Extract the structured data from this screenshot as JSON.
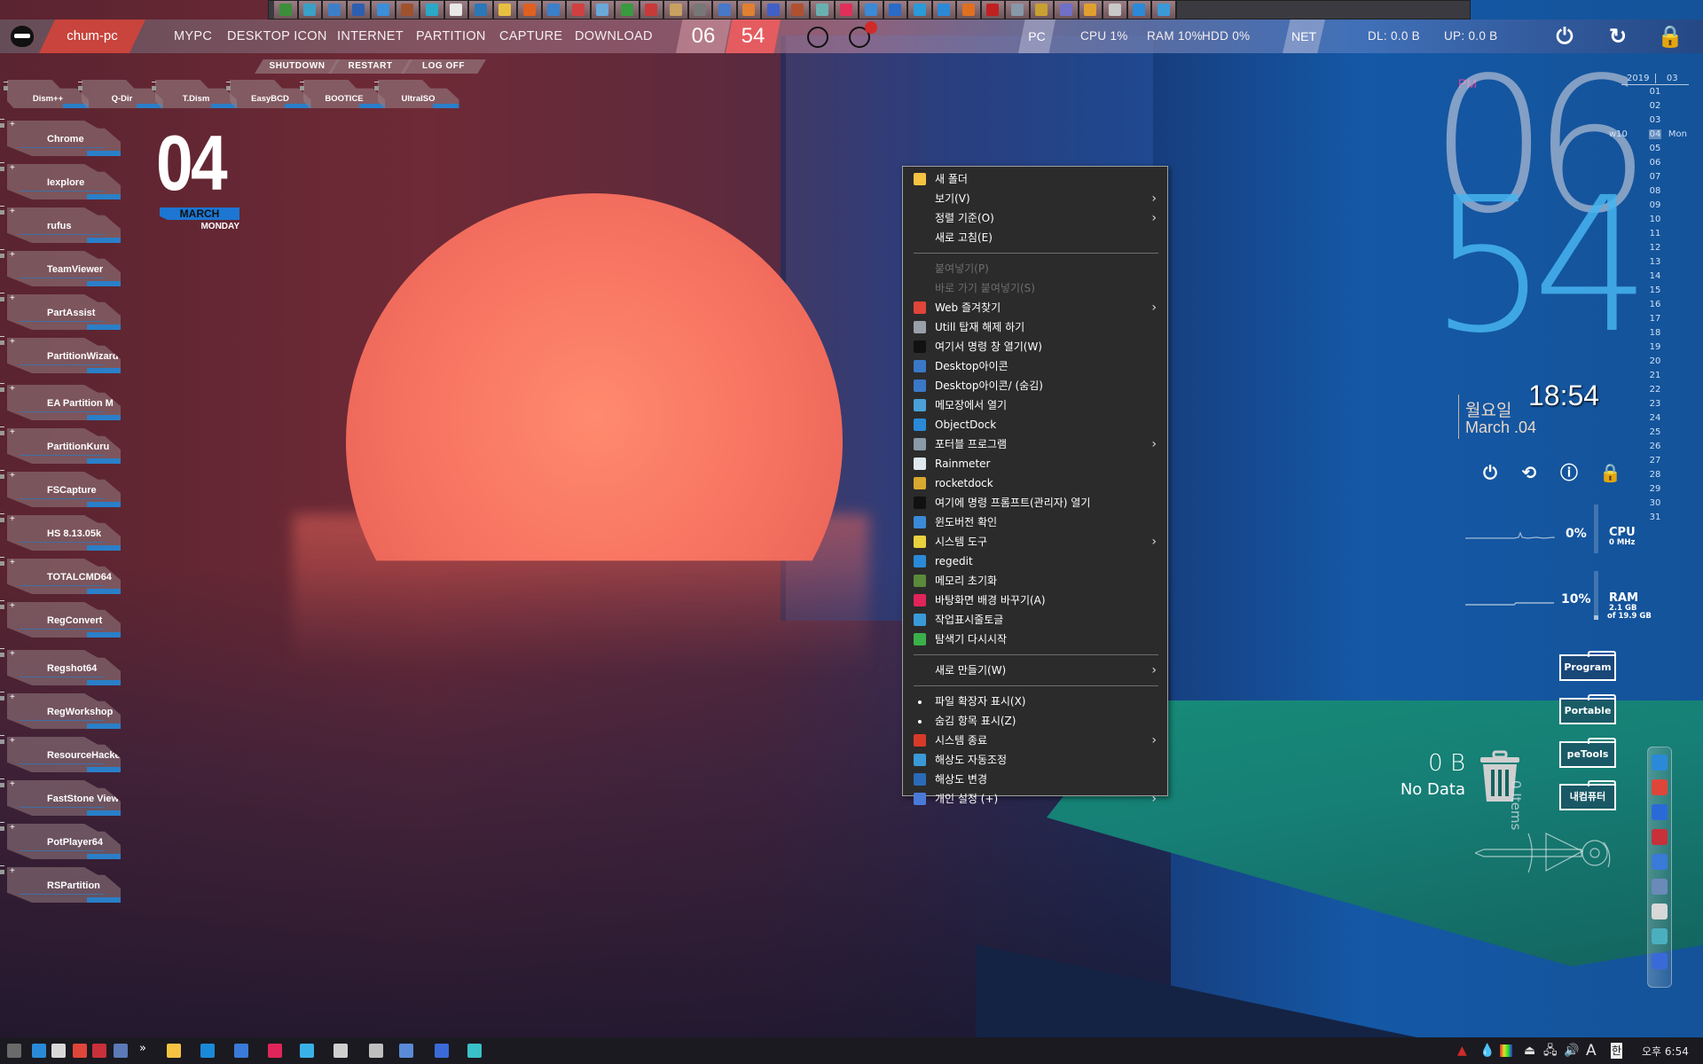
{
  "top_dock": {
    "icons": [
      "windows-flag",
      "delta-triangle",
      "tiles",
      "a-app",
      "cubes",
      "bridge",
      "cyan-circle",
      "usb-drive",
      "backup-clock",
      "wand",
      "orange-doc",
      "pen-tool",
      "colorful-orb",
      "monitor-drop",
      "green-drive",
      "ms-office",
      "cd-drive",
      "usb-stick",
      "pc-setup",
      "orange-disc",
      "floppy-save",
      "recovery-text",
      "tall-doc",
      "pink-monitor",
      "gears",
      "web-globe",
      "teamviewer-ring",
      "ie",
      "firefox",
      "red-window",
      "water-drop",
      "rocketdock-r",
      "paint",
      "rs-logo",
      "doc-pen",
      "play-triangle",
      "blue-cog"
    ],
    "colors": [
      "#3c8f3a",
      "#3aa0c8",
      "#3c7fc8",
      "#2c5fb0",
      "#3a8fd8",
      "#a0522d",
      "#2aa8c8",
      "#e8e8e8",
      "#2a78b8",
      "#e8c040",
      "#e06020",
      "#3a7fc8",
      "#d04040",
      "#6aa8d8",
      "#3a9a40",
      "#c83a3a",
      "#c8a060",
      "#777777",
      "#4878c8",
      "#e08030",
      "#4060c8",
      "#b05030",
      "#6ab0b0",
      "#e0305a",
      "#3a8ad8",
      "#2a6ac8",
      "#2a9ad8",
      "#2a8ad8",
      "#e07020",
      "#c02020",
      "#8898a8",
      "#c8a030",
      "#7070c8",
      "#e0a030",
      "#c8c8c8",
      "#2a8ad8",
      "#3a9ad8"
    ]
  },
  "topbar": {
    "host": "chum-pc",
    "menu": [
      "MYPC",
      "DESKTOP ICON",
      "INTERNET",
      "PARTITION",
      "CAPTURE",
      "DOWNLOAD"
    ],
    "clock_hour": "06",
    "clock_minute": "54",
    "pc_tag": "PC",
    "cpu": "CPU  1%",
    "ram": "RAM  10%",
    "hdd": "HDD  0%",
    "net_tag": "NET",
    "dl": "DL: 0.0 B",
    "up": "UP: 0.0 B"
  },
  "launcher": {
    "system": [
      "SHUTDOWN",
      "RESTART",
      "LOG OFF"
    ],
    "top_tiles": [
      "Dism++",
      "Q-Dir",
      "T.Dism",
      "EasyBCD",
      "BOOTICE",
      "UltraISO"
    ],
    "side_tiles": [
      "Chrome",
      "Iexplore",
      "rufus",
      "TeamViewer",
      "PartAssist",
      "PartitionWizard",
      "EA Partition M",
      "PartitionKuru",
      "FSCapture",
      "HS 8.13.05k",
      "TOTALCMD64",
      "RegConvert",
      "Regshot64",
      "RegWorkshop",
      "ResourceHacker",
      "FastStone Viewer",
      "PotPlayer64",
      "RSPartition"
    ]
  },
  "date_widget": {
    "day": "04",
    "month": "MARCH",
    "weekday": "MONDAY"
  },
  "context_menu": {
    "items": [
      {
        "label": "새 폴더",
        "icon": "folder-icon",
        "color": "#f5c242",
        "type": "item"
      },
      {
        "label": "보기(V)",
        "submenu": true,
        "type": "item"
      },
      {
        "label": "정렬 기준(O)",
        "submenu": true,
        "type": "item"
      },
      {
        "label": "새로 고침(E)",
        "type": "item"
      },
      {
        "type": "separator"
      },
      {
        "label": "붙여넣기(P)",
        "disabled": true,
        "type": "item"
      },
      {
        "label": "바로 가기 붙여넣기(S)",
        "disabled": true,
        "type": "item"
      },
      {
        "label": "Web 즐겨찾기",
        "icon": "chrome-icon",
        "color": "#e0453a",
        "submenu": true,
        "type": "item"
      },
      {
        "label": "Utill 탑재 해제 하기",
        "icon": "unmount-icon",
        "color": "#9aa0a8",
        "type": "item"
      },
      {
        "label": "여기서 명령 창 열기(W)",
        "icon": "cmd-icon",
        "color": "#111111",
        "type": "item"
      },
      {
        "label": "Desktop아이콘",
        "icon": "monitor-icon",
        "color": "#3a78c8",
        "type": "item"
      },
      {
        "label": "Desktop아이콘/ (숨김)",
        "icon": "monitor-icon",
        "color": "#3a78c8",
        "type": "item"
      },
      {
        "label": "메모장에서 열기",
        "icon": "notepad-icon",
        "color": "#4aa0d8",
        "type": "item"
      },
      {
        "label": "ObjectDock",
        "icon": "objectdock-icon",
        "color": "#2a8ad8",
        "type": "item"
      },
      {
        "label": "포터블 프로그램",
        "icon": "portable-icon",
        "color": "#8a9aa8",
        "submenu": true,
        "type": "item"
      },
      {
        "label": "Rainmeter",
        "icon": "rainmeter-drop-icon",
        "color": "#dfe8ef",
        "type": "item"
      },
      {
        "label": "rocketdock",
        "icon": "rocketdock-icon",
        "color": "#d8a830",
        "type": "item"
      },
      {
        "label": "여기에 명령 프롬프트(관리자) 열기",
        "icon": "cmd-icon",
        "color": "#111111",
        "type": "item"
      },
      {
        "label": "윈도버전 확인",
        "icon": "winver-icon",
        "color": "#3a8ad8",
        "type": "item"
      },
      {
        "label": "시스템 도구",
        "icon": "system-tools-icon",
        "color": "#e8d040",
        "submenu": true,
        "type": "item"
      },
      {
        "label": "regedit",
        "icon": "regedit-icon",
        "color": "#2a8ad8",
        "type": "item"
      },
      {
        "label": "메모리 초기화",
        "icon": "memory-icon",
        "color": "#5a8a3a",
        "type": "item"
      },
      {
        "label": "바탕화면 배경 바꾸기(A)",
        "icon": "wallpaper-icon",
        "color": "#e0255a",
        "type": "item"
      },
      {
        "label": "작업표시줄토글",
        "icon": "taskbar-icon",
        "color": "#3a9ad8",
        "type": "item"
      },
      {
        "label": "탐색기 다시시작",
        "icon": "refresh-icon",
        "color": "#3ab04a",
        "type": "item"
      },
      {
        "type": "separator"
      },
      {
        "label": "새로 만들기(W)",
        "submenu": true,
        "type": "item"
      },
      {
        "type": "separator"
      },
      {
        "label": "파일 확장자 표시(X)",
        "bullet": true,
        "type": "item"
      },
      {
        "label": "숨김 항목 표시(Z)",
        "bullet": true,
        "type": "item"
      },
      {
        "label": "시스템 종료",
        "icon": "shutdown-icon",
        "color": "#d83a2a",
        "submenu": true,
        "type": "item"
      },
      {
        "label": "해상도 자동조정",
        "icon": "display-icon",
        "color": "#3a9ad8",
        "type": "item"
      },
      {
        "label": "해상도 변경",
        "icon": "display-icon",
        "color": "#2a6ab8",
        "type": "item"
      },
      {
        "label": "개인 설정 (+)",
        "icon": "personalize-icon",
        "color": "#4a7ad8",
        "submenu": true,
        "type": "item"
      }
    ]
  },
  "right_clock": {
    "ampm": "PM",
    "hour": "06",
    "minute": "54",
    "time24": "18:54",
    "weekday_ko": "월요일",
    "date": "March .04"
  },
  "calendar": {
    "year": "2019",
    "month": "03",
    "week": "w10",
    "today": "04",
    "today_name": "Mon",
    "days": [
      "01",
      "02",
      "03",
      "04",
      "05",
      "06",
      "07",
      "08",
      "09",
      "10",
      "11",
      "12",
      "13",
      "14",
      "15",
      "16",
      "17",
      "18",
      "19",
      "20",
      "21",
      "22",
      "23",
      "24",
      "25",
      "26",
      "27",
      "28",
      "29",
      "30",
      "31"
    ]
  },
  "power_icons": [
    "power-icon",
    "restart-icon",
    "logoff-icon",
    "lock-icon"
  ],
  "meters": {
    "cpu": {
      "name": "CPU",
      "pct_label": "0%",
      "pct": 0,
      "sub": "0 MHz"
    },
    "ram": {
      "name": "RAM",
      "pct_label": "10%",
      "pct": 10,
      "sub1": "2.1 GB",
      "sub2": "of 19.9 GB"
    }
  },
  "folders": [
    "Program",
    "Portable",
    "peTools",
    "내컴퓨터"
  ],
  "recycle_bin": {
    "size": "0 B",
    "status": "No Data",
    "items": "0 Items"
  },
  "side_dock": {
    "icons": [
      "ie-icon",
      "chrome-icon",
      "signal-icon",
      "grid-app-icon",
      "monitor-app-icon",
      "computer-icon",
      "diamond-icon",
      "book-icon",
      "network-icon"
    ],
    "colors": [
      "#2a8ad8",
      "#e0453a",
      "#2a6ad8",
      "#c8303a",
      "#3a7ad8",
      "#6a8ab8",
      "#d8d8d8",
      "#4ab0c0",
      "#3a6ad8"
    ]
  },
  "taskbar": {
    "icons": [
      "start-icon",
      "app-cyan-icon",
      "diamond-icon",
      "chrome-icon",
      "grid-app-icon",
      "computer-icon",
      "overflow-chevron-icon",
      "explorer-icon",
      "teamviewer-icon",
      "desktop-icon",
      "wallpaper-icon",
      "screenshot-icon",
      "usb-icon",
      "drive-icon",
      "network-icon",
      "user-network-icon",
      "doc-icon"
    ],
    "colors": [
      "#6a6a6a",
      "#2a8ad8",
      "#d8d8d8",
      "#e0453a",
      "#c8303a",
      "#5a7ab8",
      "#ffffff",
      "#f5c242",
      "#1a8ad8",
      "#3a7ad8",
      "#e0255a",
      "#3ab0e8",
      "#cfcfcf",
      "#bfbfbf",
      "#5a8ad8",
      "#3a6ad8",
      "#3ac0c8"
    ],
    "tray": {
      "icons": [
        "network-tri-icon",
        "rainmeter-drop-icon",
        "color-grid-icon",
        "usb-eject-icon",
        "network-adapter-icon",
        "volume-icon",
        "ime-a-icon",
        "ime-hangul-icon"
      ],
      "ime_a": "A",
      "ime_hangul": "한",
      "clock": "오후 6:54"
    }
  }
}
